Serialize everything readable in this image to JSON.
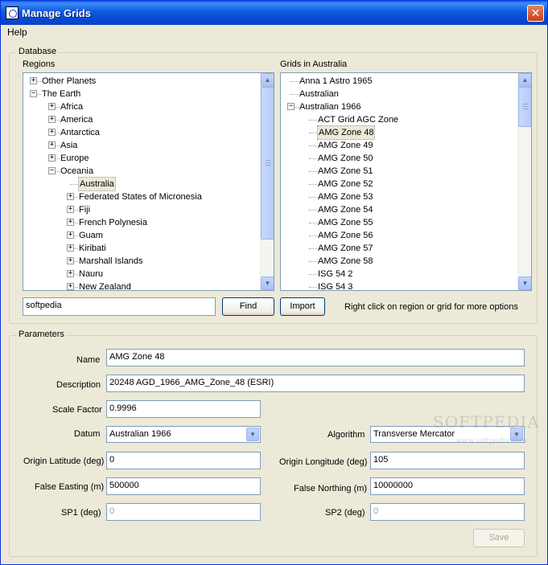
{
  "window": {
    "title": "Manage Grids",
    "close": "✕"
  },
  "menu": {
    "help": "Help"
  },
  "database": {
    "legend": "Database",
    "regions_label": "Regions",
    "grids_label": "Grids in Australia",
    "regions": [
      {
        "label": "Other Planets",
        "expander": "+"
      },
      {
        "label": "The Earth",
        "expander": "−"
      },
      {
        "label": "Africa",
        "expander": "+"
      },
      {
        "label": "America",
        "expander": "+"
      },
      {
        "label": "Antarctica",
        "expander": "+"
      },
      {
        "label": "Asia",
        "expander": "+"
      },
      {
        "label": "Europe",
        "expander": "+"
      },
      {
        "label": "Oceania",
        "expander": "−"
      },
      {
        "label": "Australia",
        "expander": ""
      },
      {
        "label": "Federated States of Micronesia",
        "expander": "+"
      },
      {
        "label": "Fiji",
        "expander": "+"
      },
      {
        "label": "French Polynesia",
        "expander": "+"
      },
      {
        "label": "Guam",
        "expander": "+"
      },
      {
        "label": "Kiribati",
        "expander": "+"
      },
      {
        "label": "Marshall Islands",
        "expander": "+"
      },
      {
        "label": "Nauru",
        "expander": "+"
      },
      {
        "label": "New Zealand",
        "expander": "+"
      }
    ],
    "grids": [
      {
        "label": "Anna 1 Astro 1965",
        "expander": ""
      },
      {
        "label": "Australian",
        "expander": ""
      },
      {
        "label": "Australian 1966",
        "expander": "−"
      },
      {
        "label": "ACT Grid AGC Zone",
        "expander": ""
      },
      {
        "label": "AMG Zone 48",
        "expander": ""
      },
      {
        "label": "AMG Zone 49",
        "expander": ""
      },
      {
        "label": "AMG Zone 50",
        "expander": ""
      },
      {
        "label": "AMG Zone 51",
        "expander": ""
      },
      {
        "label": "AMG Zone 52",
        "expander": ""
      },
      {
        "label": "AMG Zone 53",
        "expander": ""
      },
      {
        "label": "AMG Zone 54",
        "expander": ""
      },
      {
        "label": "AMG Zone 55",
        "expander": ""
      },
      {
        "label": "AMG Zone 56",
        "expander": ""
      },
      {
        "label": "AMG Zone 57",
        "expander": ""
      },
      {
        "label": "AMG Zone 58",
        "expander": ""
      },
      {
        "label": "ISG 54 2",
        "expander": ""
      },
      {
        "label": "ISG 54 3",
        "expander": ""
      }
    ],
    "search_value": "softpedia",
    "find_label": "Find",
    "import_label": "Import",
    "hint": "Right click on region or grid for more options"
  },
  "parameters": {
    "legend": "Parameters",
    "name_label": "Name",
    "name_value": "AMG Zone 48",
    "description_label": "Description",
    "description_value": "20248 AGD_1966_AMG_Zone_48 (ESRI)",
    "scale_factor_label": "Scale Factor",
    "scale_factor_value": "0.9996",
    "datum_label": "Datum",
    "datum_value": "Australian 1966",
    "algorithm_label": "Algorithm",
    "algorithm_value": "Transverse Mercator",
    "origin_lat_label": "Origin Latitude (deg)",
    "origin_lat_value": "0",
    "origin_lon_label": "Origin Longitude (deg)",
    "origin_lon_value": "105",
    "false_easting_label": "False Easting (m)",
    "false_easting_value": "500000",
    "false_northing_label": "False Northing (m)",
    "false_northing_value": "10000000",
    "sp1_label": "SP1 (deg)",
    "sp1_value": "0",
    "sp2_label": "SP2 (deg)",
    "sp2_value": "0",
    "save_label": "Save"
  },
  "watermark": {
    "text": "SOFTPEDIA",
    "url": "www.softpedia.com"
  },
  "colors": {
    "titlebar": "#0a5fe6",
    "dialog": "#ece9d8",
    "field_border": "#7f9db9"
  }
}
